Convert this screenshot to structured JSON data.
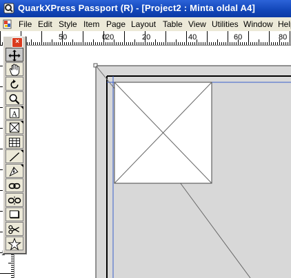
{
  "window": {
    "title": "QuarkXPress Passport (R) - [Project2 : Minta oldal A4]"
  },
  "menu": {
    "items": [
      "File",
      "Edit",
      "Style",
      "Item",
      "Page",
      "Layout",
      "Table",
      "View",
      "Utilities",
      "Window",
      "Help"
    ]
  },
  "rulers": {
    "horizontal_labels": [
      "50",
      "20",
      "0",
      "20",
      "40",
      "60",
      "80"
    ],
    "vertical_labels": [
      "1"
    ]
  },
  "tools": [
    {
      "name": "item-tool",
      "icon": "move-arrows-icon",
      "selected": true,
      "submenu": false
    },
    {
      "name": "grabber-tool",
      "icon": "hand-icon",
      "selected": false,
      "submenu": false
    },
    {
      "name": "rotation-tool",
      "icon": "rotate-icon",
      "selected": false,
      "submenu": false
    },
    {
      "name": "zoom-tool",
      "icon": "magnifier-icon",
      "selected": false,
      "submenu": false
    },
    {
      "name": "text-box-tool",
      "icon": "text-box-icon",
      "selected": false,
      "submenu": true
    },
    {
      "name": "picture-box-tool",
      "icon": "picture-box-icon",
      "selected": false,
      "submenu": true
    },
    {
      "name": "table-tool",
      "icon": "table-icon",
      "selected": false,
      "submenu": false
    },
    {
      "name": "line-tool",
      "icon": "line-icon",
      "selected": false,
      "submenu": true
    },
    {
      "name": "bezier-tool",
      "icon": "pen-icon",
      "selected": false,
      "submenu": true
    },
    {
      "name": "linking-tool",
      "icon": "chain-link-icon",
      "selected": false,
      "submenu": false
    },
    {
      "name": "unlinking-tool",
      "icon": "broken-chain-icon",
      "selected": false,
      "submenu": false
    },
    {
      "name": "composition-zone-tool",
      "icon": "rectangle-icon",
      "selected": false,
      "submenu": false
    },
    {
      "name": "scissors-tool",
      "icon": "scissors-icon",
      "selected": false,
      "submenu": false
    },
    {
      "name": "starburst-tool",
      "icon": "star-icon",
      "selected": false,
      "submenu": false
    }
  ],
  "colors": {
    "titlebar": "#1246b8",
    "pasteboard": "#d8d8d8",
    "page": "#ffffff",
    "margin_guide": "#3a5fcd",
    "page_border": "#000000"
  }
}
